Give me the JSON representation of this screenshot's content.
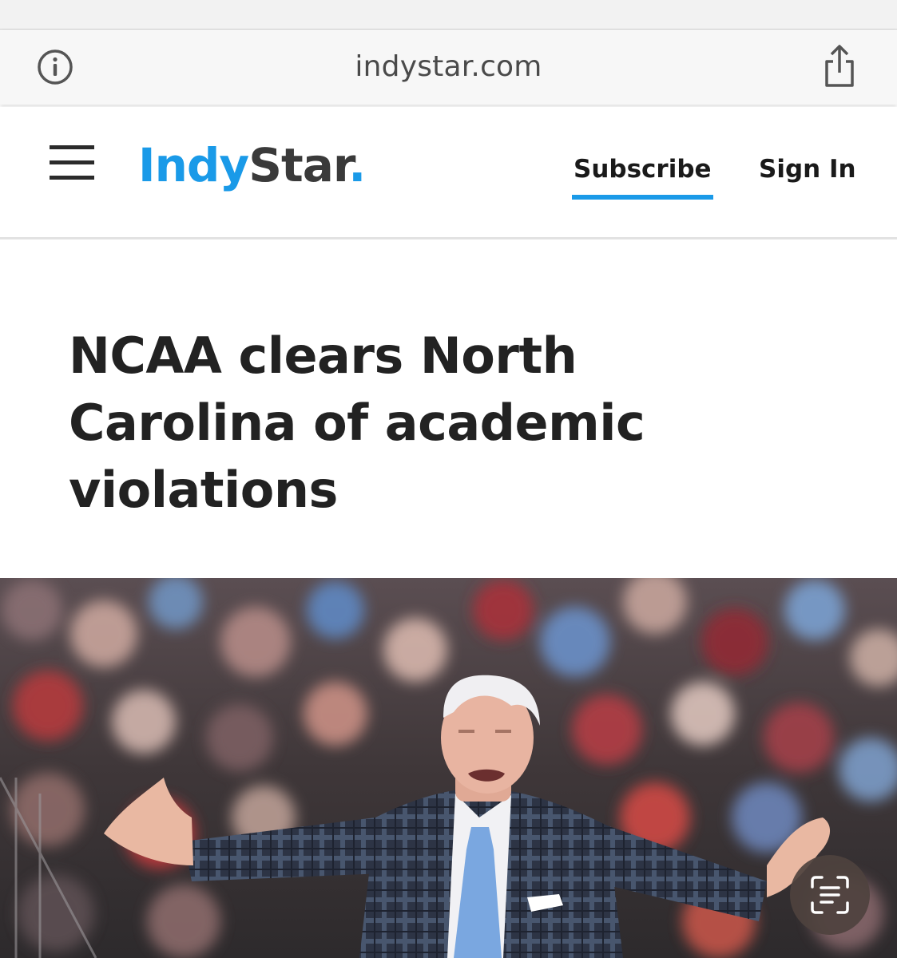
{
  "browser": {
    "url": "indystar.com",
    "icons": [
      "info-icon",
      "share-icon"
    ]
  },
  "header": {
    "logo_part1": "Indy",
    "logo_part2": "Star",
    "logo_dot": ".",
    "subscribe_label": "Subscribe",
    "signin_label": "Sign In",
    "menu_icon": "hamburger-menu-icon"
  },
  "article": {
    "headline": "NCAA clears North Carolina of academic violations"
  },
  "colors": {
    "brand_blue": "#1a9ae8",
    "text_dark": "#222222"
  },
  "overlay": {
    "icon": "live-text-scan-icon"
  }
}
